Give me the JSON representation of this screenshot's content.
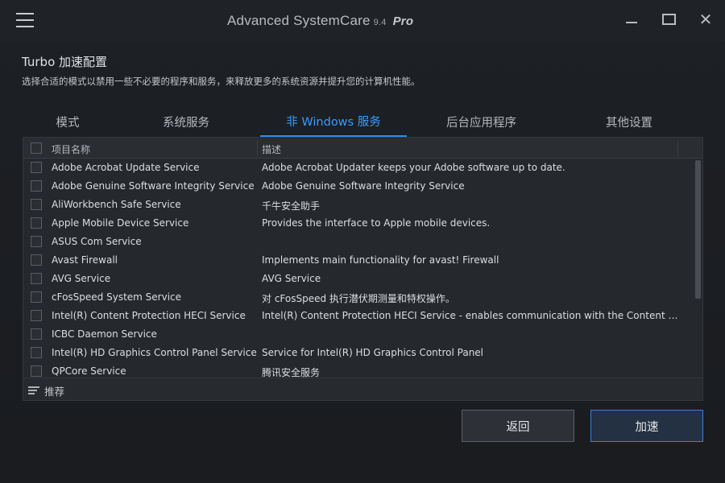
{
  "titlebar": {
    "app_name": "Advanced SystemCare",
    "version": "9.4",
    "edition": "Pro",
    "close_glyph": "✕"
  },
  "header": {
    "title": "Turbo 加速配置",
    "description": "选择合适的模式以禁用一些不必要的程序和服务，来释放更多的系统资源并提升您的计算机性能。"
  },
  "tabs": [
    {
      "label": "模式",
      "active": false
    },
    {
      "label": "系统服务",
      "active": false
    },
    {
      "label": "非 Windows 服务",
      "active": true
    },
    {
      "label": "后台应用程序",
      "active": false
    },
    {
      "label": "其他设置",
      "active": false
    }
  ],
  "table": {
    "columns": {
      "name": "项目名称",
      "description": "描述"
    },
    "rows": [
      {
        "name": "Adobe Acrobat Update Service",
        "description": "Adobe Acrobat Updater keeps your Adobe software up to date."
      },
      {
        "name": "Adobe Genuine Software Integrity Service",
        "description": "Adobe Genuine Software Integrity Service"
      },
      {
        "name": "AliWorkbench Safe Service",
        "description": "千牛安全助手"
      },
      {
        "name": "Apple Mobile Device Service",
        "description": "Provides the interface to Apple mobile devices."
      },
      {
        "name": "ASUS Com Service",
        "description": ""
      },
      {
        "name": "Avast Firewall",
        "description": "Implements main functionality for avast! Firewall"
      },
      {
        "name": "AVG Service",
        "description": "AVG Service"
      },
      {
        "name": "cFosSpeed System Service",
        "description": "对 cFosSpeed 执行潜伏期测量和特权操作。"
      },
      {
        "name": "Intel(R) Content Protection HECI Service",
        "description": "Intel(R) Content Protection HECI Service - enables communication with the Content Prote..."
      },
      {
        "name": "ICBC Daemon Service",
        "description": ""
      },
      {
        "name": "Intel(R) HD Graphics Control Panel Service",
        "description": "Service for Intel(R) HD Graphics Control Panel"
      },
      {
        "name": "QPCore Service",
        "description": "腾讯安全服务"
      }
    ],
    "footer_label": "推荐"
  },
  "buttons": {
    "back": "返回",
    "accelerate": "加速"
  },
  "colors": {
    "accent": "#2d8cf0",
    "background": "#1b1d21"
  }
}
